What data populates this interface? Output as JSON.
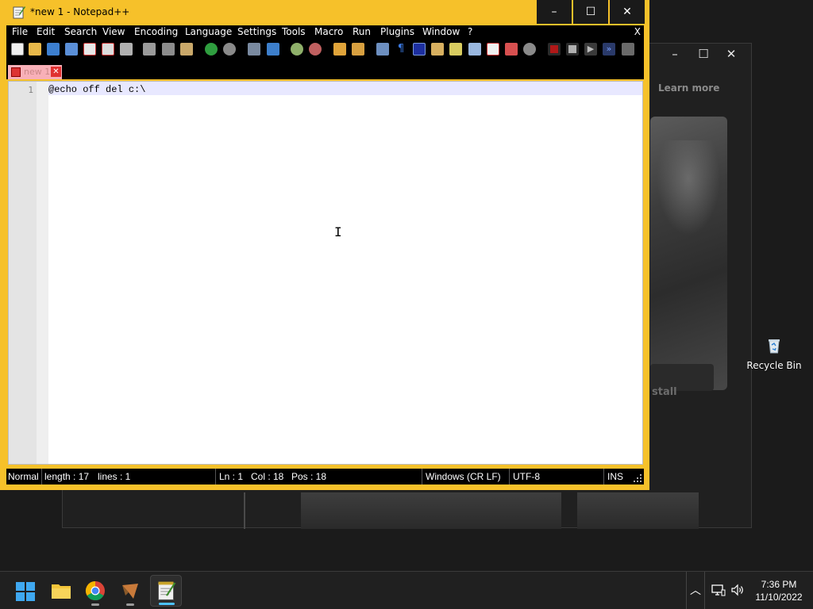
{
  "window": {
    "title": "*new 1 - Notepad++",
    "minimize_glyph": "–",
    "maximize_glyph": "☐",
    "close_glyph": "✕"
  },
  "menu": {
    "items": [
      "File",
      "Edit",
      "Search",
      "View",
      "Encoding",
      "Language",
      "Settings",
      "Tools",
      "Macro",
      "Run",
      "Plugins",
      "Window",
      "?"
    ],
    "close_label": "X"
  },
  "toolbar": {
    "icons": [
      "new-file-icon",
      "open-file-icon",
      "save-icon",
      "save-all-icon",
      "close-icon",
      "close-all-icon",
      "print-icon",
      "cut-icon",
      "copy-icon",
      "paste-icon",
      "undo-icon",
      "redo-icon",
      "find-icon",
      "replace-icon",
      "zoom-in-icon",
      "zoom-out-icon",
      "sync-vertical-icon",
      "sync-horizontal-icon",
      "word-wrap-icon",
      "show-all-characters-icon",
      "indent-guide-icon",
      "user-language-icon",
      "document-map-icon",
      "document-list-icon",
      "function-list-icon",
      "folder-as-workspace-icon",
      "monitoring-icon",
      "record-macro-icon",
      "stop-recording-icon",
      "play-macro-icon",
      "run-macro-multiple-icon",
      "save-macro-icon"
    ]
  },
  "tab": {
    "label": "new 1",
    "close_glyph": "✕"
  },
  "editor": {
    "line_number": "1",
    "content": "@echo off del c:\\",
    "cursor_glyph": "I"
  },
  "status": {
    "mode": "Normal",
    "length": "length : 17",
    "lines": "lines : 1",
    "ln": "Ln : 1",
    "col": "Col : 18",
    "pos": "Pos : 18",
    "eol": "Windows (CR LF)",
    "encoding": "UTF-8",
    "insert_mode": "INS"
  },
  "background_window": {
    "learn_more": "Learn more",
    "install_fragment": "stall",
    "minimize_glyph": "–",
    "maximize_glyph": "☐",
    "close_glyph": "✕"
  },
  "desktop": {
    "recycle_bin_label": "Recycle Bin"
  },
  "taskbar": {
    "apps": [
      "start-menu",
      "file-explorer",
      "google-chrome",
      "app",
      "notepad-plus-plus"
    ],
    "tray_chevron": "︿",
    "time": "7:36 PM",
    "date": "11/10/2022"
  },
  "colors": {
    "titlebar": "#f6c12a",
    "bars": "#000000",
    "taskbar": "#202020",
    "accent": "#4cc2ff"
  }
}
